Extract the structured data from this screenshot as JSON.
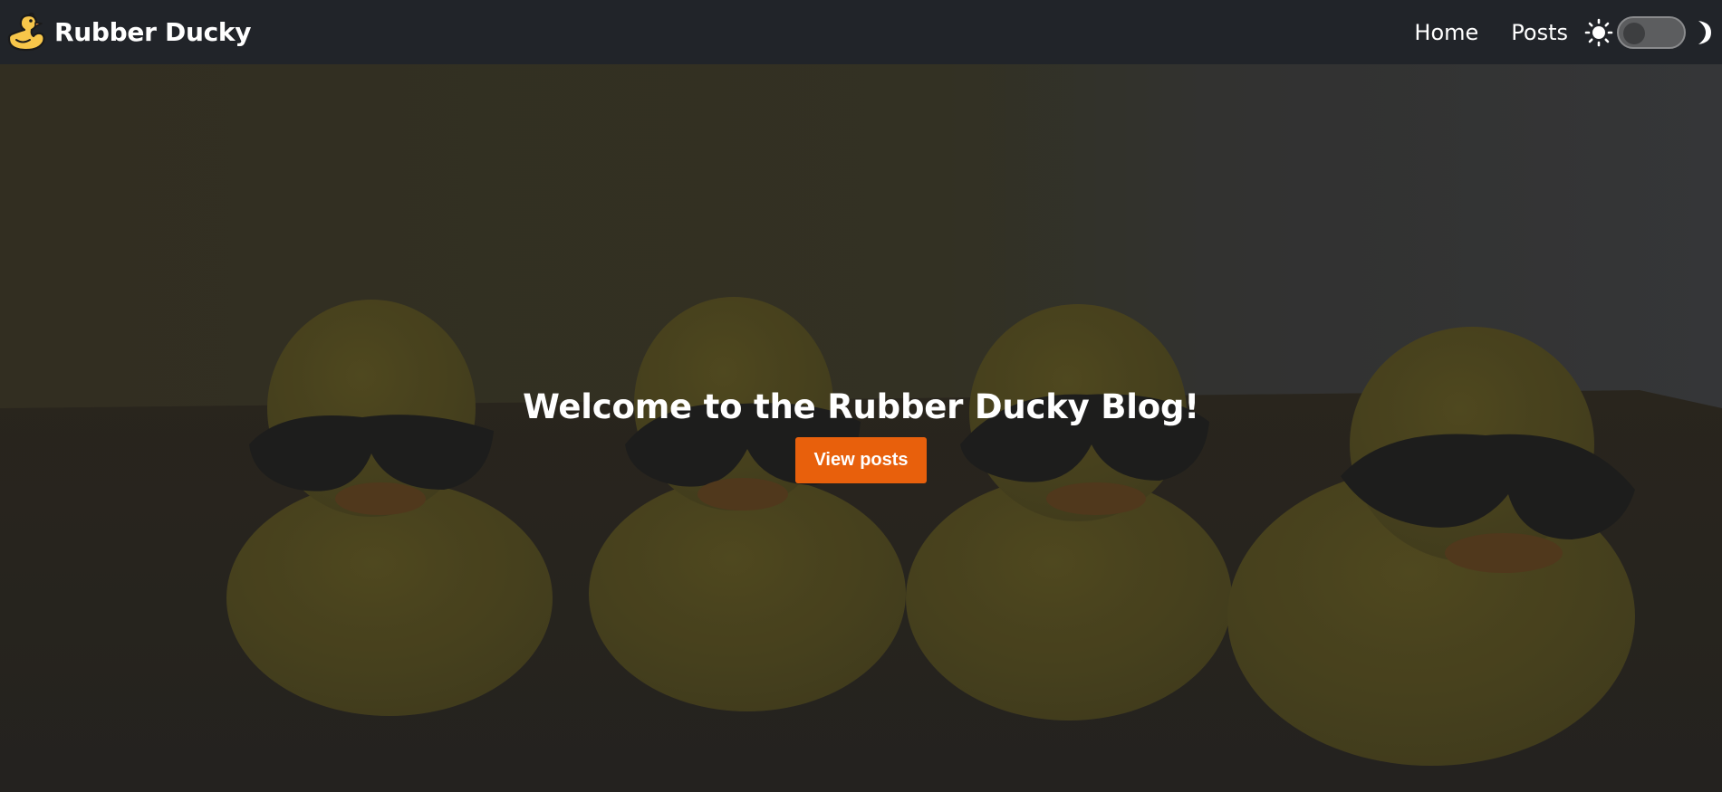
{
  "navbar": {
    "brand_name": "Rubber Ducky",
    "logo_icon": "rubber-duck-icon",
    "links": [
      {
        "label": "Home"
      },
      {
        "label": "Posts"
      }
    ],
    "theme_toggle": {
      "light_icon": "sun-icon",
      "dark_icon": "moon-icon",
      "dark_mode_on": false
    }
  },
  "hero": {
    "background_image": "rubber ducks wearing sunglasses",
    "title": "Welcome to the Rubber Ducky Blog!",
    "button_label": "View posts"
  },
  "colors": {
    "navbar_bg": "#212429",
    "accent": "#e8600c",
    "duck_yellow": "#f7c64a",
    "text": "#ffffff"
  }
}
